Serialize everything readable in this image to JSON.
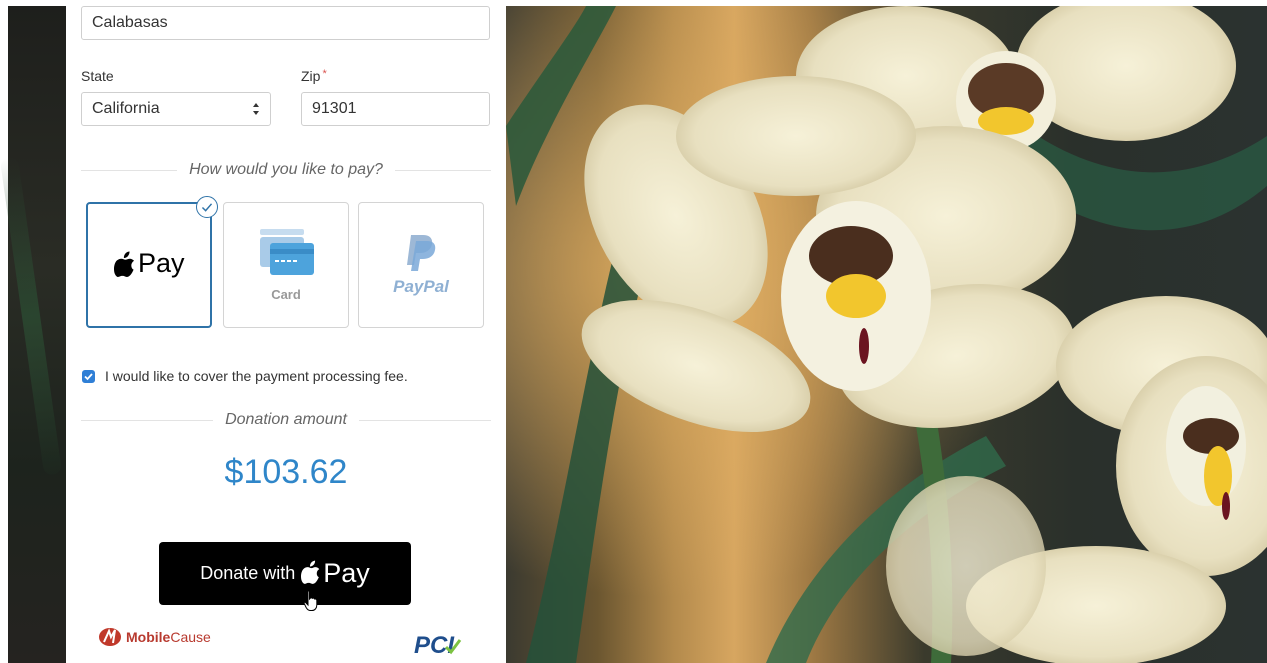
{
  "form": {
    "city_value": "Calabasas",
    "state_label": "State",
    "state_value": "California",
    "zip_label": "Zip",
    "zip_required_mark": "*",
    "zip_value": "91301",
    "pay_prompt": "How would you like to pay?",
    "payment_options": [
      {
        "label": "Pay",
        "icon": "apple-icon",
        "selected": true
      },
      {
        "label": "Card",
        "icon": "credit-card-icon",
        "selected": false
      },
      {
        "label": "PayPal",
        "icon": "paypal-icon",
        "selected": false
      }
    ],
    "cover_fee_label": "I would like to cover the payment processing fee.",
    "cover_fee_checked": true,
    "donation_heading": "Donation amount",
    "donation_amount": "$103.62",
    "donate_button_label": "Donate with",
    "donate_button_pay": "Pay",
    "footer_logo_brand": "Mobile",
    "footer_logo_suffix": "Cause",
    "pci_logo": "PCI"
  },
  "colors": {
    "accent_blue": "#2f86c9",
    "selected_border": "#2f73a8",
    "button_bg": "#000000"
  }
}
